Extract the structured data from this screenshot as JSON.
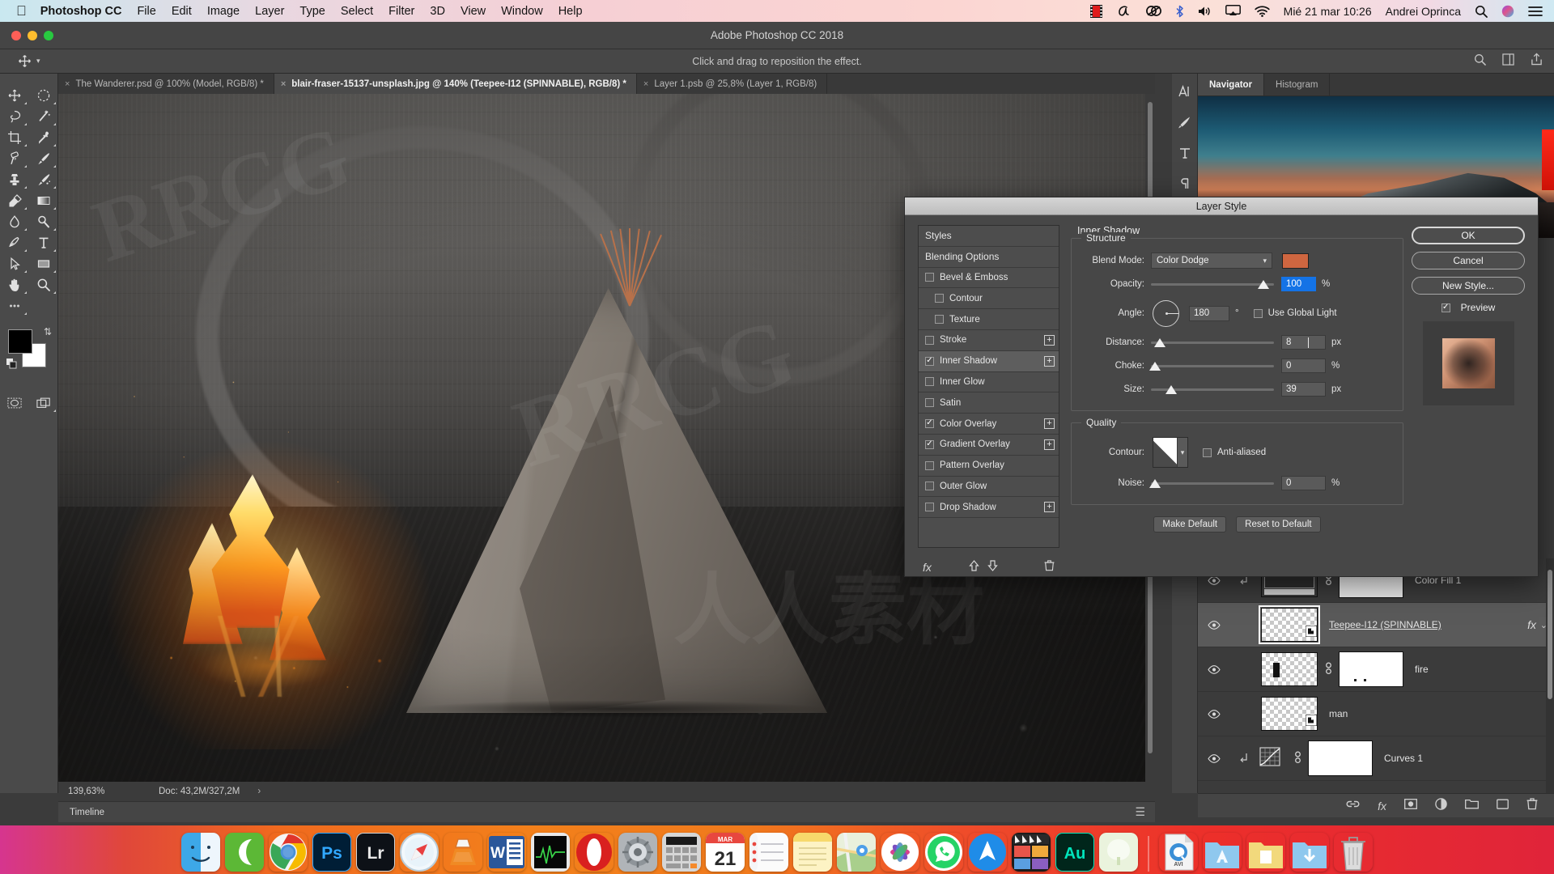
{
  "menubar": {
    "apple_icon": "apple-icon",
    "app_name": "Photoshop CC",
    "items": [
      "File",
      "Edit",
      "Image",
      "Layer",
      "Type",
      "Select",
      "Filter",
      "3D",
      "View",
      "Window",
      "Help"
    ],
    "status_icons": [
      "film-strip-icon",
      "script-a-icon",
      "creative-cloud-icon",
      "bluetooth-icon",
      "volume-icon",
      "airplay-icon",
      "wifi-icon"
    ],
    "datetime": "Mié 21 mar  10:26",
    "user": "Andrei Oprinca",
    "right_icons": [
      "search-icon",
      "siri-icon",
      "control-center-icon"
    ]
  },
  "window": {
    "title": "Adobe Photoshop CC 2018"
  },
  "options_bar": {
    "tool": "move-tool",
    "hint": "Click and drag to reposition the effect.",
    "right_icons": [
      "search-icon",
      "workspace-icon",
      "share-icon"
    ]
  },
  "tabs": [
    {
      "label": "The Wanderer.psd @ 100% (Model, RGB/8) *",
      "active": false
    },
    {
      "label": "blair-fraser-15137-unsplash.jpg @ 140% (Teepee-I12 (SPINNABLE), RGB/8) *",
      "active": true
    },
    {
      "label": "Layer 1.psb @ 25,8% (Layer 1, RGB/8)",
      "active": false
    }
  ],
  "toolbar": {
    "tools": [
      "move-tool",
      "marquee-tool",
      "lasso-tool",
      "magic-wand-tool",
      "crop-tool",
      "eyedropper-tool",
      "healing-brush-tool",
      "brush-tool",
      "clone-stamp-tool",
      "history-brush-tool",
      "eraser-tool",
      "gradient-tool",
      "blur-tool",
      "dodge-tool",
      "pen-tool",
      "type-tool",
      "path-selection-tool",
      "rectangle-tool",
      "hand-tool",
      "zoom-tool",
      "more-tools-icon"
    ],
    "foreground_color": "#000000",
    "background_color": "#ffffff",
    "bottom_tools": [
      "quick-mask-icon",
      "screen-mode-icon"
    ]
  },
  "status_bar": {
    "zoom": "139,63%",
    "doc": "Doc: 43,2M/327,2M",
    "arrow": "›"
  },
  "timeline": {
    "label": "Timeline",
    "menu_icon": "panel-menu-icon"
  },
  "right_dock": {
    "icons": [
      "character-panel-icon",
      "brush-panel-icon",
      "type-panel-icon",
      "paragraph-panel-icon"
    ]
  },
  "panels": {
    "tabs": [
      {
        "label": "Navigator",
        "active": true
      },
      {
        "label": "Histogram",
        "active": false
      }
    ]
  },
  "layers": [
    {
      "name": "Color Fill 1",
      "visible": true,
      "clipped": true,
      "has_mask": true,
      "selected": false,
      "kind": "adjustment",
      "fx": false
    },
    {
      "name": "Teepee-I12 (SPINNABLE)",
      "visible": true,
      "clipped": false,
      "has_mask": false,
      "selected": true,
      "kind": "smart-object",
      "fx": true,
      "fx_label": "fx"
    },
    {
      "name": "fire",
      "visible": true,
      "clipped": false,
      "has_mask": true,
      "selected": false,
      "kind": "pixel",
      "fx": false
    },
    {
      "name": "man",
      "visible": true,
      "clipped": false,
      "has_mask": false,
      "selected": false,
      "kind": "smart-object",
      "fx": false
    },
    {
      "name": "Curves 1",
      "visible": true,
      "clipped": true,
      "has_mask": true,
      "selected": false,
      "kind": "curves",
      "fx": false
    }
  ],
  "layers_toolbar_icons": [
    "link-layers-icon",
    "add-fx-icon",
    "add-mask-icon",
    "new-adjustment-icon",
    "new-group-icon",
    "new-layer-icon",
    "delete-layer-icon"
  ],
  "dialog": {
    "title": "Layer Style",
    "styles": [
      {
        "label": "Styles",
        "type": "header",
        "checkbox": false,
        "checked": false,
        "indent": false,
        "plus": false,
        "selected": false
      },
      {
        "label": "Blending Options",
        "type": "header",
        "checkbox": false,
        "checked": false,
        "indent": false,
        "plus": false,
        "selected": false
      },
      {
        "label": "Bevel & Emboss",
        "type": "effect",
        "checkbox": true,
        "checked": false,
        "indent": false,
        "plus": false,
        "selected": false
      },
      {
        "label": "Contour",
        "type": "sub",
        "checkbox": true,
        "checked": false,
        "indent": true,
        "plus": false,
        "selected": false
      },
      {
        "label": "Texture",
        "type": "sub",
        "checkbox": true,
        "checked": false,
        "indent": true,
        "plus": false,
        "selected": false
      },
      {
        "label": "Stroke",
        "type": "effect",
        "checkbox": true,
        "checked": false,
        "indent": false,
        "plus": true,
        "selected": false
      },
      {
        "label": "Inner Shadow",
        "type": "effect",
        "checkbox": true,
        "checked": true,
        "indent": false,
        "plus": true,
        "selected": true
      },
      {
        "label": "Inner Glow",
        "type": "effect",
        "checkbox": true,
        "checked": false,
        "indent": false,
        "plus": false,
        "selected": false
      },
      {
        "label": "Satin",
        "type": "effect",
        "checkbox": true,
        "checked": false,
        "indent": false,
        "plus": false,
        "selected": false
      },
      {
        "label": "Color Overlay",
        "type": "effect",
        "checkbox": true,
        "checked": true,
        "indent": false,
        "plus": true,
        "selected": false
      },
      {
        "label": "Gradient Overlay",
        "type": "effect",
        "checkbox": true,
        "checked": true,
        "indent": false,
        "plus": true,
        "selected": false
      },
      {
        "label": "Pattern Overlay",
        "type": "effect",
        "checkbox": true,
        "checked": false,
        "indent": false,
        "plus": false,
        "selected": false
      },
      {
        "label": "Outer Glow",
        "type": "effect",
        "checkbox": true,
        "checked": false,
        "indent": false,
        "plus": false,
        "selected": false
      },
      {
        "label": "Drop Shadow",
        "type": "effect",
        "checkbox": true,
        "checked": false,
        "indent": false,
        "plus": true,
        "selected": false
      }
    ],
    "styles_footer_icons": [
      "fx-icon",
      "move-up-icon",
      "move-down-icon",
      "trash-icon"
    ],
    "settings": {
      "section_title": "Inner Shadow",
      "structure_legend": "Structure",
      "blend_mode_label": "Blend Mode:",
      "blend_mode_value": "Color Dodge",
      "shadow_color": "#cf6640",
      "opacity_label": "Opacity:",
      "opacity_value": "100",
      "opacity_unit": "%",
      "angle_label": "Angle:",
      "angle_value": "180",
      "angle_unit": "°",
      "global_light_label": "Use Global Light",
      "global_light_checked": false,
      "distance_label": "Distance:",
      "distance_value": "8",
      "distance_unit": "px",
      "choke_label": "Choke:",
      "choke_value": "0",
      "choke_unit": "%",
      "size_label": "Size:",
      "size_value": "39",
      "size_unit": "px",
      "quality_legend": "Quality",
      "contour_label": "Contour:",
      "antialiased_label": "Anti-aliased",
      "antialiased_checked": false,
      "noise_label": "Noise:",
      "noise_value": "0",
      "noise_unit": "%",
      "make_default": "Make Default",
      "reset_default": "Reset to Default"
    },
    "buttons": {
      "ok": "OK",
      "cancel": "Cancel",
      "new_style": "New Style...",
      "preview_label": "Preview",
      "preview_checked": true
    }
  },
  "dock": {
    "items": [
      {
        "name": "finder",
        "label": "",
        "bg": "#4aaee8",
        "running": true
      },
      {
        "name": "contacts",
        "label": "",
        "bg": "#5cb836",
        "running": true
      },
      {
        "name": "chrome",
        "label": "",
        "bg": "#ffffff",
        "running": true
      },
      {
        "name": "photoshop",
        "label": "Ps",
        "bg": "#001e36",
        "running": true
      },
      {
        "name": "lightroom",
        "label": "Lr",
        "bg": "#1a1a1a",
        "running": false
      },
      {
        "name": "safari",
        "label": "",
        "bg": "#e8f3fb",
        "running": false
      },
      {
        "name": "vlc",
        "label": "",
        "bg": "#f2873a",
        "running": false
      },
      {
        "name": "word",
        "label": "W",
        "bg": "#2b579a",
        "running": false
      },
      {
        "name": "activity-monitor",
        "label": "",
        "bg": "#0b0b0b",
        "running": false
      },
      {
        "name": "opera",
        "label": "",
        "bg": "#d9201f",
        "running": true
      },
      {
        "name": "system-preferences",
        "label": "",
        "bg": "#9a9a9a",
        "running": true
      },
      {
        "name": "calculator",
        "label": "",
        "bg": "#d9d9d9",
        "running": false
      },
      {
        "name": "calendar",
        "label": "21",
        "bg": "#ffffff",
        "running": false
      },
      {
        "name": "reminders",
        "label": "",
        "bg": "#f7f7f7",
        "running": false
      },
      {
        "name": "notes",
        "label": "",
        "bg": "#fde38a",
        "running": false
      },
      {
        "name": "maps",
        "label": "",
        "bg": "#e8f0d8",
        "running": false
      },
      {
        "name": "photos",
        "label": "",
        "bg": "#ffffff",
        "running": false
      },
      {
        "name": "whatsapp",
        "label": "",
        "bg": "#25d366",
        "running": false
      },
      {
        "name": "spark-mail",
        "label": "",
        "bg": "#1a8ae5",
        "running": true
      },
      {
        "name": "final-cut-pro",
        "label": "",
        "bg": "#1c1c1c",
        "running": false
      },
      {
        "name": "audition",
        "label": "Au",
        "bg": "#00261b",
        "running": false
      },
      {
        "name": "forest",
        "label": "",
        "bg": "#e4f0d8",
        "running": false
      },
      {
        "name": "separator",
        "label": "",
        "bg": "",
        "running": false
      },
      {
        "name": "avi-file",
        "label": "",
        "bg": "#f0f0f0",
        "running": false
      },
      {
        "name": "applications-folder",
        "label": "",
        "bg": "#8fc8ee",
        "running": false
      },
      {
        "name": "documents-folder",
        "label": "",
        "bg": "#f2d97c",
        "running": false
      },
      {
        "name": "downloads-folder",
        "label": "",
        "bg": "#8fc8ee",
        "running": false
      },
      {
        "name": "trash",
        "label": "",
        "bg": "#e8e8e8",
        "running": false
      }
    ]
  }
}
